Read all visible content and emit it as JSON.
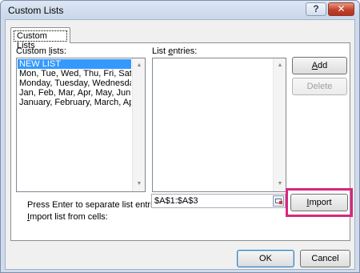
{
  "window": {
    "title": "Custom Lists",
    "help_label": "?",
    "close_label": "✕"
  },
  "tab": {
    "label": "Custom Lists"
  },
  "custom_lists": {
    "label_pre": "Custom ",
    "label_u": "l",
    "label_post": "ists:",
    "items": [
      "NEW LIST",
      "Mon, Tue, Wed, Thu, Fri, Sat, S",
      "Monday, Tuesday, Wednesday",
      "Jan, Feb, Mar, Apr, May, Jun, Ju",
      "January, February, March, Apri"
    ],
    "selected_index": 0
  },
  "list_entries": {
    "label_pre": "List ",
    "label_u": "e",
    "label_post": "ntries:"
  },
  "buttons": {
    "add_u": "A",
    "add_rest": "dd",
    "delete": "Delete",
    "import_u": "I",
    "import_rest": "mport",
    "ok": "OK",
    "cancel": "Cancel"
  },
  "hint": "Press Enter to separate list entries.",
  "import_label": {
    "u": "I",
    "rest": "mport list from cells:"
  },
  "import_range": "$A$1:$A$3",
  "scroll_up": "▲",
  "scroll_down": "▼",
  "colors": {
    "highlight": "#d9267f",
    "selection": "#3399ff"
  }
}
